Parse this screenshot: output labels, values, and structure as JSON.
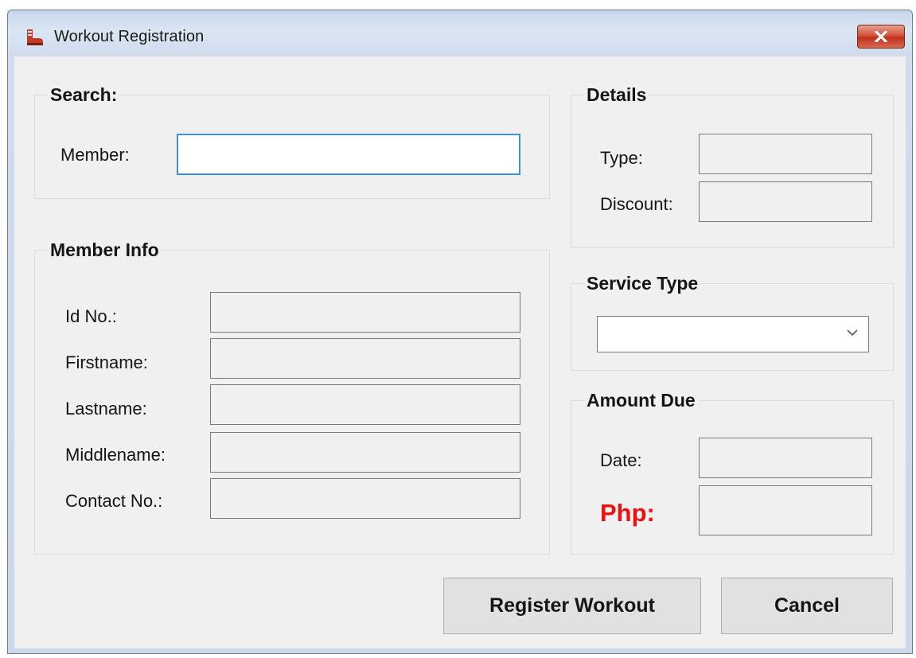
{
  "window": {
    "title": "Workout Registration"
  },
  "search": {
    "title": "Search:",
    "member_label": "Member:",
    "member_value": ""
  },
  "member_info": {
    "title": "Member Info",
    "fields": [
      {
        "label": "Id No.:",
        "value": ""
      },
      {
        "label": "Firstname:",
        "value": ""
      },
      {
        "label": "Lastname:",
        "value": ""
      },
      {
        "label": "Middlename:",
        "value": ""
      },
      {
        "label": "Contact No.:",
        "value": ""
      }
    ]
  },
  "details": {
    "title": "Details",
    "type_label": "Type:",
    "type_value": "",
    "discount_label": "Discount:",
    "discount_value": ""
  },
  "service_type": {
    "title": "Service Type",
    "selected": ""
  },
  "amount_due": {
    "title": "Amount Due",
    "date_label": "Date:",
    "date_value": "",
    "php_label": "Php:",
    "php_value": ""
  },
  "buttons": {
    "register": "Register Workout",
    "cancel": "Cancel"
  },
  "colors": {
    "php_label": "#ee1111",
    "focus_border": "#3f8fd2",
    "close_button": "#c0311d"
  },
  "icons": {
    "app": "boot-icon",
    "close": "close-icon",
    "dropdown": "chevron-down-icon"
  }
}
